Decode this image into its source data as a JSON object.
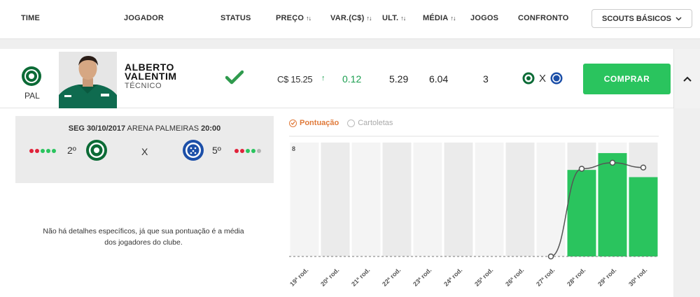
{
  "header": {
    "columns": [
      "TIME",
      "JOGADOR",
      "STATUS",
      "PREÇO",
      "VAR.(C$)",
      "ULT.",
      "MÉDIA",
      "JOGOS",
      "CONFRONTO"
    ],
    "sort_symbol": "↑↓",
    "scouts_button": "SCOUTS BÁSICOS"
  },
  "player": {
    "club_abbr": "PAL",
    "name": "ALBERTO VALENTIM",
    "position": "TÉCNICO",
    "price": "C$ 15.25",
    "variation": "0.12",
    "last": "5.29",
    "average": "6.04",
    "games": "3",
    "vs_symbol": "X",
    "buy_label": "COMPRAR"
  },
  "match": {
    "date_label": "SEG 30/10/2017",
    "venue": "ARENA PALMEIRAS",
    "time": "20:00",
    "home_rank": "2º",
    "away_rank": "5º",
    "vs": "X",
    "home_form": [
      "loss",
      "loss",
      "win",
      "win",
      "win"
    ],
    "away_form": [
      "loss",
      "loss",
      "win",
      "win",
      "draw"
    ]
  },
  "note": "Não há detalhes específicos, já que sua pontuação é a média dos jogadores do clube.",
  "legend": {
    "pontuacao": "Pontuação",
    "cartoletas": "Cartoletas"
  },
  "colors": {
    "green": "#2ac45e",
    "win": "#2ac45e",
    "loss": "#e0223a",
    "draw": "#b5b5b5",
    "accent": "#e07a3a"
  },
  "chart_data": {
    "type": "bar",
    "categories": [
      "19ª rod.",
      "20ª rod.",
      "21ª rod.",
      "22ª rod.",
      "23ª rod.",
      "24ª rod.",
      "25ª rod.",
      "26ª rod.",
      "27ª rod.",
      "28ª rod.",
      "29ª rod.",
      "30ª rod."
    ],
    "values": [
      null,
      null,
      null,
      null,
      null,
      null,
      null,
      null,
      0,
      7.2,
      8.6,
      6.6
    ],
    "line_values": [
      null,
      null,
      null,
      null,
      null,
      null,
      null,
      null,
      0,
      7.3,
      7.8,
      7.4
    ],
    "y_tick_label": "8",
    "ylim": [
      0,
      10
    ]
  }
}
